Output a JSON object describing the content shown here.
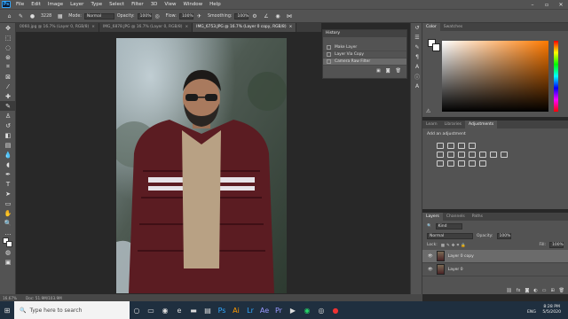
{
  "menu": [
    "File",
    "Edit",
    "Image",
    "Layer",
    "Type",
    "Select",
    "Filter",
    "3D",
    "View",
    "Window",
    "Help"
  ],
  "app_logo": "Ps",
  "options": {
    "brush_size": "3228",
    "mode_label": "Mode:",
    "mode_value": "Normal",
    "opacity_label": "Opacity:",
    "opacity_value": "100%",
    "flow_label": "Flow:",
    "flow_value": "100%",
    "smoothing_label": "Smoothing:",
    "smoothing_value": "100%"
  },
  "doc_tabs": [
    {
      "label": "0060.jpg @ 16.7% (Layer 0, RGB/8)",
      "active": false
    },
    {
      "label": "IMG_6878.JPG @ 16.7% (Layer 0, RGB/8)",
      "active": false
    },
    {
      "label": "IMG_6753.JPG @ 16.7% (Layer 0 copy, RGB/8)",
      "active": true
    }
  ],
  "history": {
    "title": "History",
    "items": [
      "Make Layer",
      "Layer Via Copy",
      "Camera Raw Filter"
    ]
  },
  "color_panel": {
    "tabs": [
      "Color",
      "Swatches"
    ],
    "fg": "#ffffff",
    "bg": "#ffffff"
  },
  "adjust_panel": {
    "tabs": [
      "Learn",
      "Libraries",
      "Adjustments"
    ],
    "hint": "Add an adjustment"
  },
  "layers_panel": {
    "tabs": [
      "Layers",
      "Channels",
      "Paths"
    ],
    "kind": "Kind",
    "blend": "Normal",
    "opacity_label": "Opacity:",
    "opacity": "100%",
    "lock_label": "Lock:",
    "fill_label": "Fill:",
    "fill": "100%",
    "layers": [
      "Layer 0 copy",
      "Layer 0"
    ]
  },
  "status": {
    "zoom": "16.67%",
    "doc": "Doc: 51.9M/103.9M"
  },
  "taskbar": {
    "search": "Type here to search",
    "lang": "ENG",
    "time": "8:28 PM",
    "date": "5/5/2020"
  }
}
